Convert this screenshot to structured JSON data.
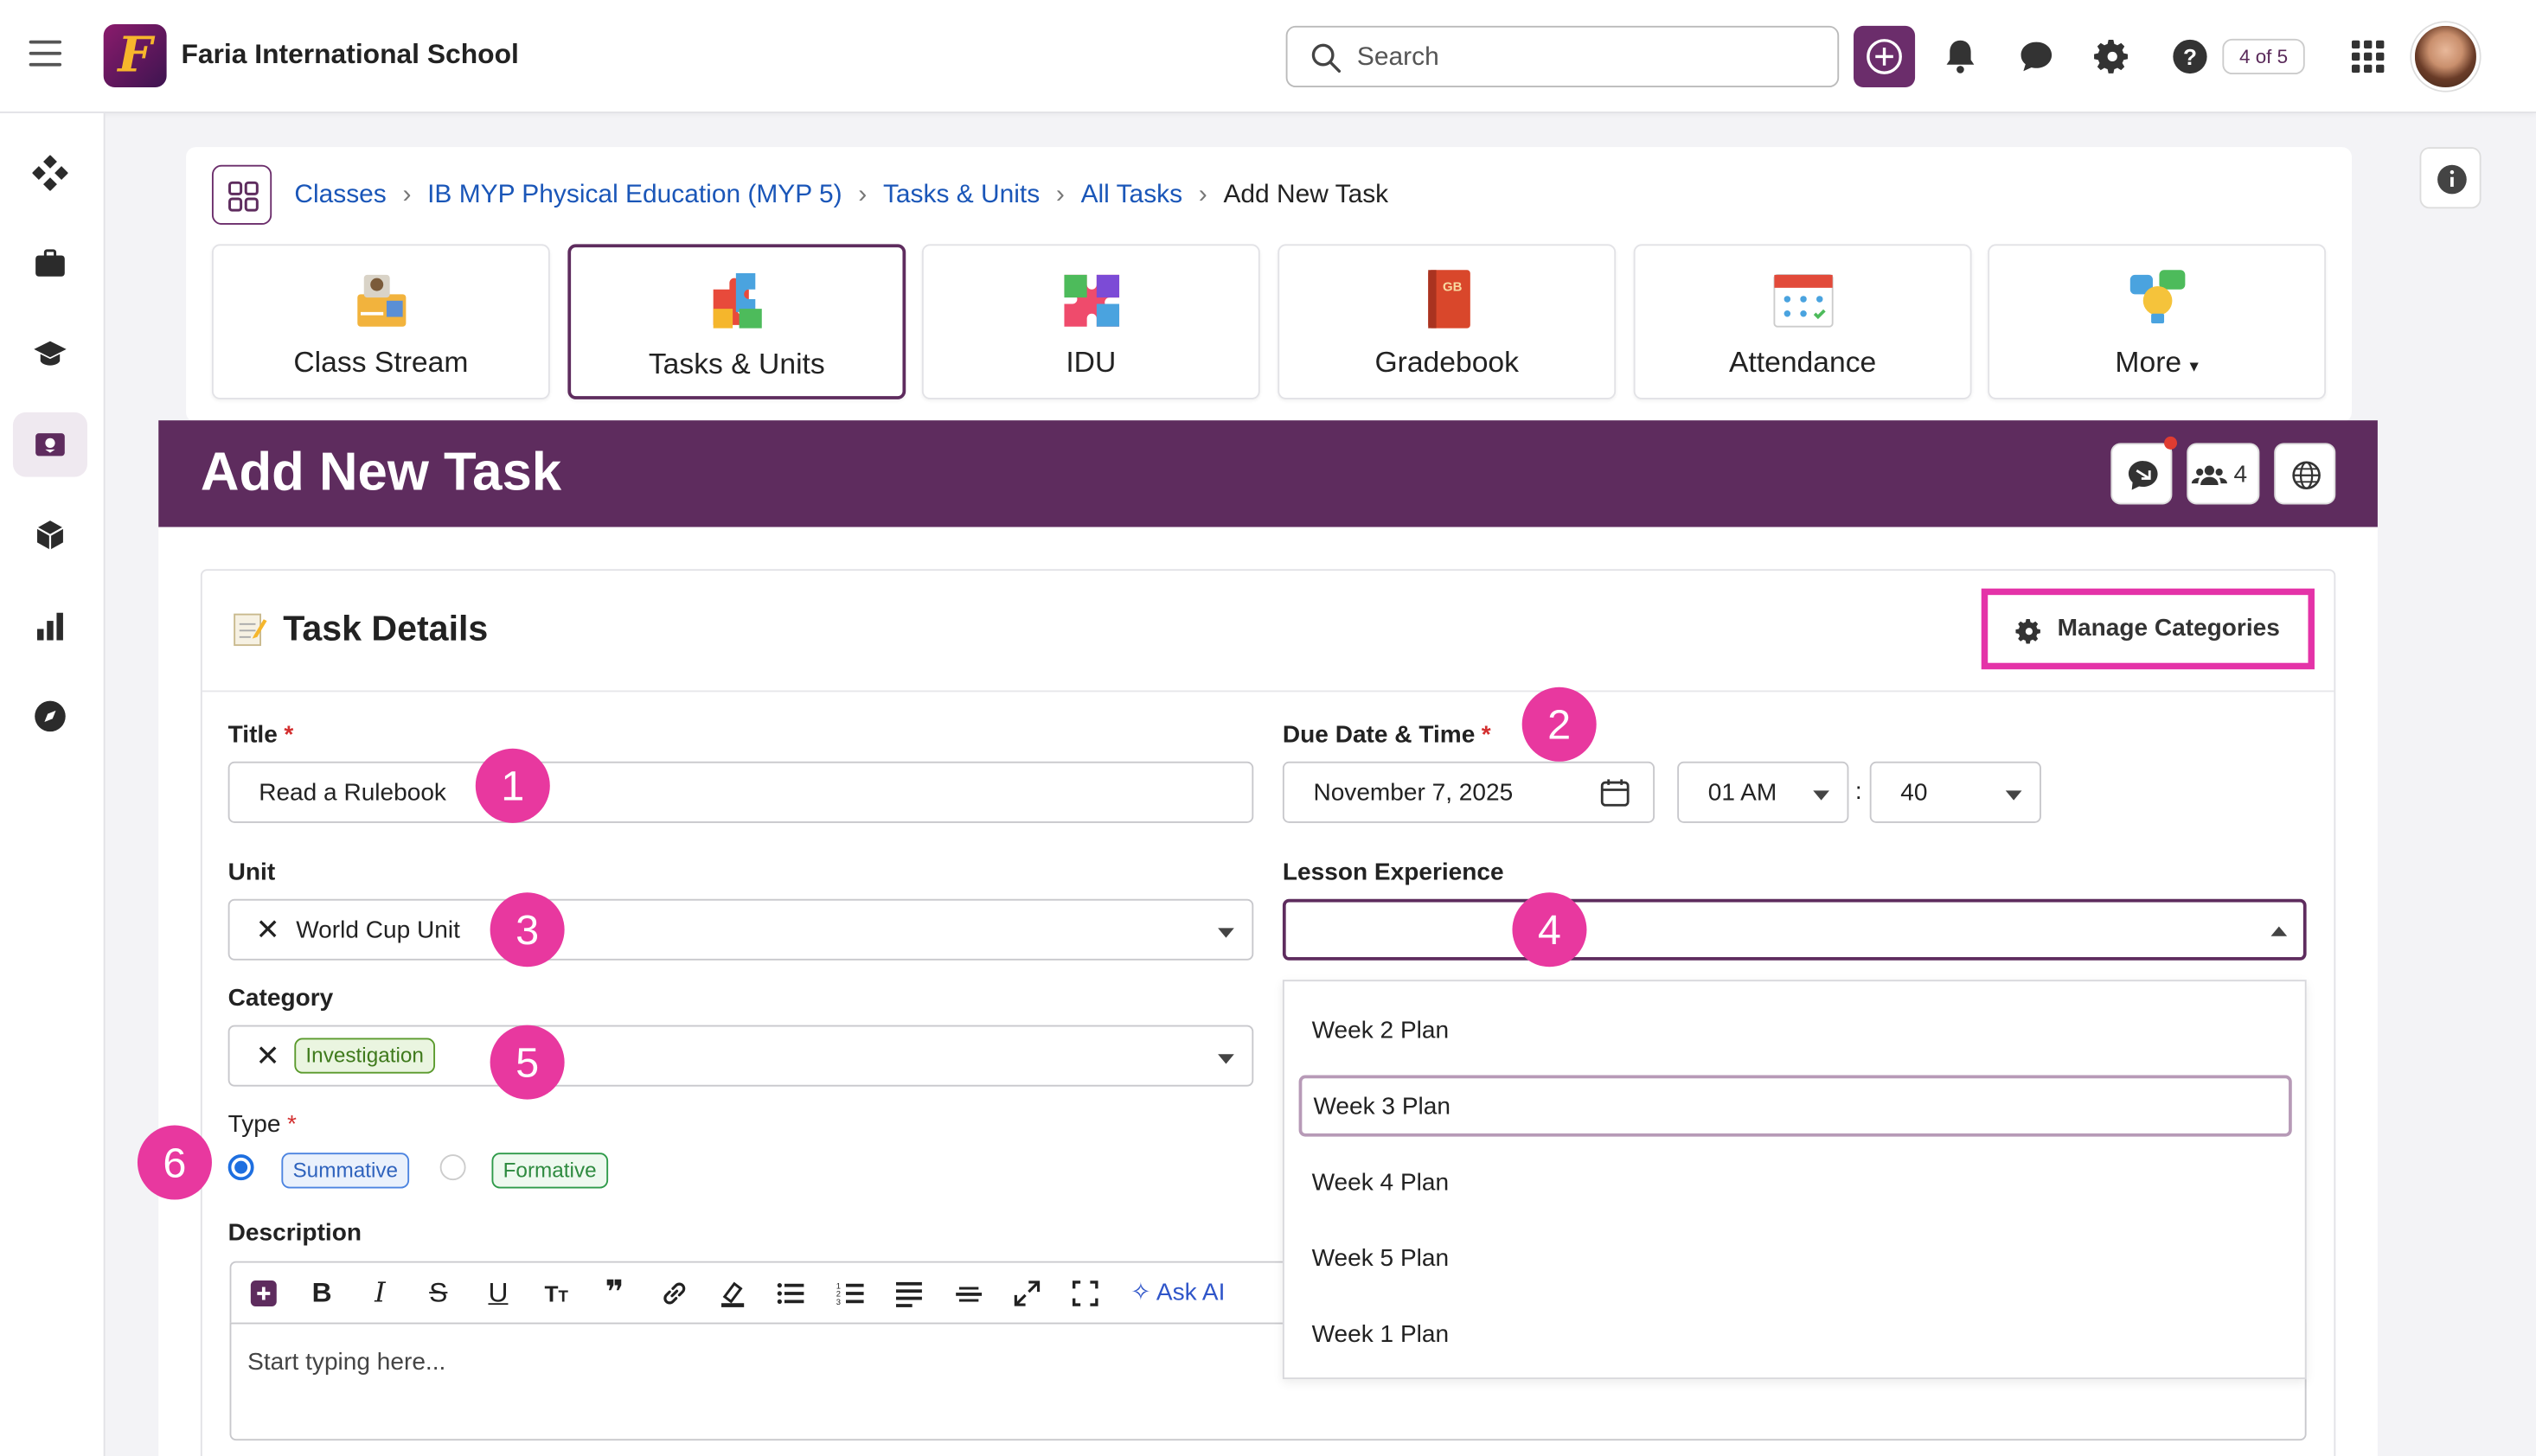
{
  "header": {
    "logo_letter": "F",
    "school_name": "Faria International School",
    "search_placeholder": "Search",
    "counter": "4 of 5"
  },
  "breadcrumb": {
    "items": [
      "Classes",
      "IB MYP Physical Education (MYP 5)",
      "Tasks & Units",
      "All Tasks"
    ],
    "current": "Add New Task"
  },
  "tiles": [
    {
      "label": "Class Stream",
      "icon": "class-stream-icon"
    },
    {
      "label": "Tasks & Units",
      "icon": "tasks-units-icon",
      "active": true
    },
    {
      "label": "IDU",
      "icon": "idu-puzzle-icon"
    },
    {
      "label": "Gradebook",
      "icon": "gradebook-icon"
    },
    {
      "label": "Attendance",
      "icon": "attendance-calendar-icon"
    },
    {
      "label": "More",
      "icon": "more-icon"
    }
  ],
  "page": {
    "title": "Add New Task",
    "students_count": "4"
  },
  "section": {
    "title": "Task Details",
    "manage_label": "Manage Categories"
  },
  "form": {
    "title_label": "Title",
    "title_value": "Read a Rulebook",
    "due_label": "Due Date & Time",
    "due_date": "November 7, 2025",
    "hour": "01 AM",
    "minute": "40",
    "time_sep": ":",
    "unit_label": "Unit",
    "unit_value": "World Cup Unit",
    "lesson_label": "Lesson Experience",
    "category_label": "Category",
    "category_value": "Investigation",
    "type_label": "Type",
    "type_summative": "Summative",
    "type_formative": "Formative",
    "description_label": "Description",
    "ask_ai": "Ask AI",
    "editor_placeholder": "Start typing here..."
  },
  "lesson_options": [
    "Week 2 Plan",
    "Week 3 Plan",
    "Week 4 Plan",
    "Week 5 Plan",
    "Week 1 Plan"
  ],
  "badges": [
    "1",
    "2",
    "3",
    "4",
    "5",
    "6"
  ],
  "colors": {
    "brand_purple": "#5e2c5e",
    "highlight_pink": "#e433a8",
    "badge_pink": "#e8389f",
    "link_blue": "#1a56b8"
  }
}
